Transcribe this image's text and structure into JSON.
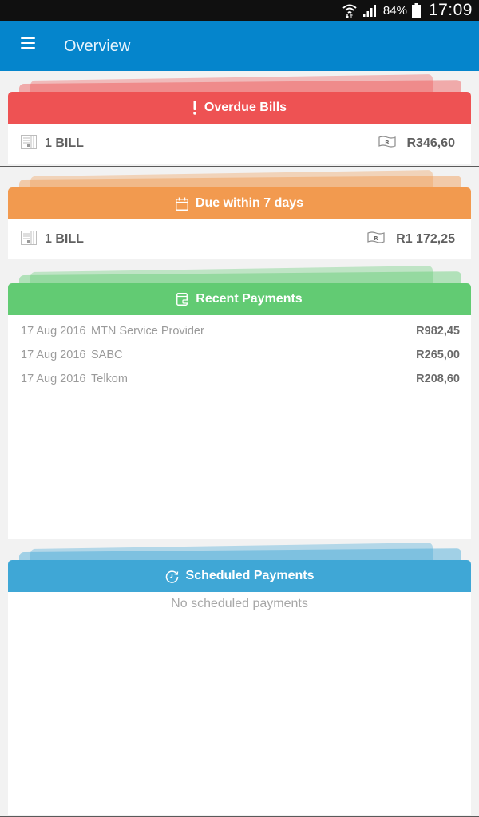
{
  "status_bar": {
    "wifi_icon": "wifi-icon",
    "signal_icon": "signal-icon",
    "battery_percent": "84%",
    "battery_icon": "battery-icon",
    "time": "17:09"
  },
  "app_bar": {
    "menu_icon": "hamburger-menu-icon",
    "title": "Overview",
    "color": "#0585cc"
  },
  "overdue": {
    "title": "Overdue Bills",
    "icon": "exclamation-icon",
    "color": "#ee5253",
    "bill_count": "1 BILL",
    "amount": "R346,60"
  },
  "due_soon": {
    "title": "Due within 7 days",
    "icon": "calendar-icon",
    "color": "#f29a4f",
    "bill_count": "1 BILL",
    "amount": "R1 172,25"
  },
  "recent_payments": {
    "title": "Recent Payments",
    "icon": "wallet-icon",
    "color": "#62cb73",
    "items": [
      {
        "date": "17 Aug 2016",
        "payee": "MTN Service Provider",
        "amount": "R982,45"
      },
      {
        "date": "17 Aug 2016",
        "payee": "SABC",
        "amount": "R265,00"
      },
      {
        "date": "17 Aug 2016",
        "payee": "Telkom",
        "amount": "R208,60"
      }
    ]
  },
  "scheduled_payments": {
    "title": "Scheduled Payments",
    "icon": "scheduled-clock-icon",
    "color": "#3fa7d6",
    "empty_text": "No scheduled payments"
  }
}
